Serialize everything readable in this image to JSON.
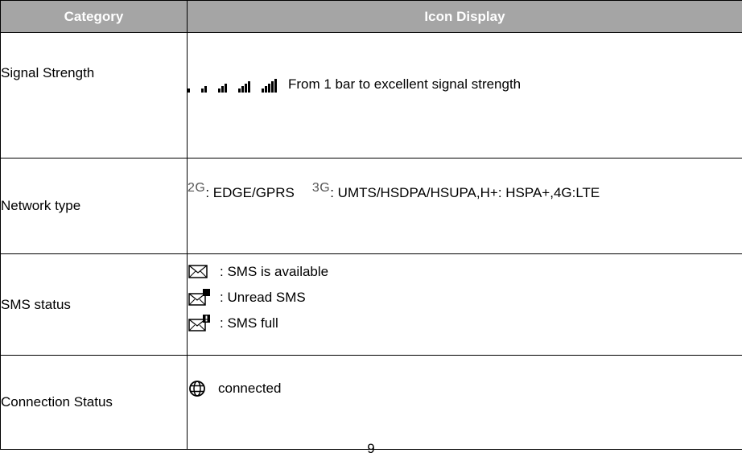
{
  "table": {
    "headers": [
      "Category",
      "Icon Display"
    ],
    "header_bg": "#a5a5a5",
    "rows": [
      {
        "category": "Signal Strength",
        "icons": [
          "signal-1-bar-icon",
          "signal-2-bars-icon",
          "signal-3-bars-icon",
          "signal-4-bars-icon",
          "signal-5-bars-icon"
        ],
        "signal_levels": [
          1,
          2,
          3,
          4,
          5
        ],
        "text": "From 1 bar to excellent signal strength"
      },
      {
        "category": "Network type",
        "items": [
          {
            "icon_label": "2G",
            "text": ": EDGE/GPRS"
          },
          {
            "icon_label": "3G",
            "text": ": UMTS/HSDPA/HSUPA,H+: HSPA+,4G:LTE"
          }
        ]
      },
      {
        "category": "SMS status",
        "items": [
          {
            "icon": "envelope-icon",
            "text": ": SMS is available"
          },
          {
            "icon": "envelope-unread-icon",
            "text": ": Unread SMS"
          },
          {
            "icon": "envelope-full-icon",
            "text": ": SMS full"
          }
        ]
      },
      {
        "category": "Connection Status",
        "icon": "globe-icon",
        "text": "connected"
      }
    ]
  },
  "page_number": "9"
}
